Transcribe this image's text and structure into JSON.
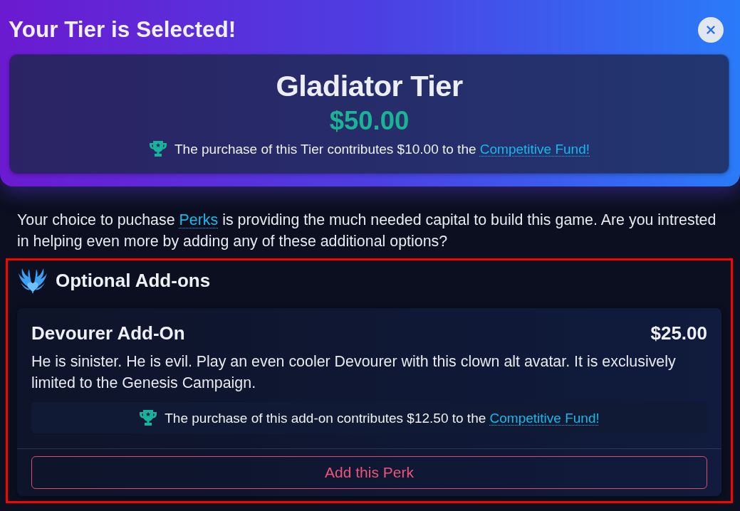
{
  "header": {
    "title": "Your Tier is Selected!"
  },
  "tier": {
    "name": "Gladiator Tier",
    "price": "$50.00",
    "contribution": {
      "text": "The purchase of this Tier contributes $10.00 to the",
      "link": "Competitive Fund!"
    }
  },
  "intro": {
    "before": "Your choice to puchase",
    "link": "Perks",
    "after": "is providing the much needed capital to build this game. Are you intrested in helping even more by adding any of these additional options?"
  },
  "addons": {
    "title": "Optional Add-ons",
    "highlighted": true,
    "items": [
      {
        "title": "Devourer Add-On",
        "price": "$25.00",
        "description": "He is sinister. He is evil. Play an even cooler Devourer with this clown alt avatar. It is exclusively limited to the Genesis Campaign.",
        "contribution": {
          "text": "The purchase of this add-on contributes $12.50 to the",
          "link": "Competitive Fund!"
        },
        "button": "Add this Perk"
      }
    ]
  }
}
